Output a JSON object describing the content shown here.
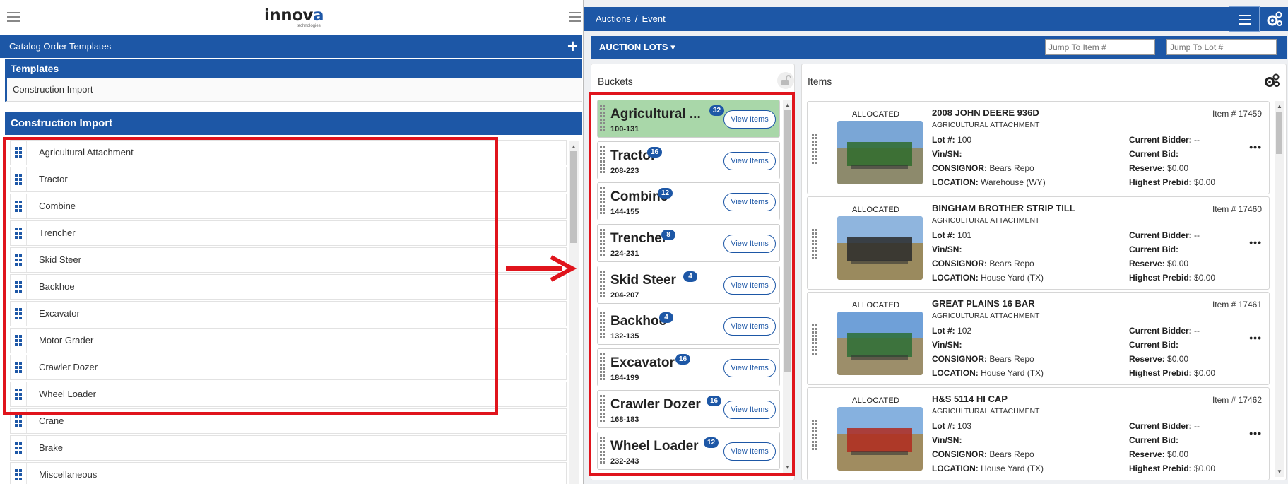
{
  "left": {
    "logo_main": "innova",
    "logo_sub": "technologies",
    "catalog_title": "Catalog Order Templates",
    "add_icon": "plus-icon",
    "templates_heading": "Templates",
    "selected_template": "Construction Import",
    "section_heading": "Construction Import",
    "items": [
      {
        "label": "Agricultural Attachment"
      },
      {
        "label": "Tractor"
      },
      {
        "label": "Combine"
      },
      {
        "label": "Trencher"
      },
      {
        "label": "Skid Steer"
      },
      {
        "label": "Backhoe"
      },
      {
        "label": "Excavator"
      },
      {
        "label": "Motor Grader"
      },
      {
        "label": "Crawler Dozer"
      },
      {
        "label": "Wheel Loader"
      },
      {
        "label": "Crane"
      },
      {
        "label": "Brake"
      },
      {
        "label": "Miscellaneous"
      }
    ]
  },
  "right": {
    "breadcrumb": {
      "first": "Auctions",
      "sep": "/",
      "second": "Event"
    },
    "lots_button": "AUCTION LOTS",
    "jump_item_placeholder": "Jump To Item #",
    "jump_lot_placeholder": "Jump To Lot #",
    "buckets_title": "Buckets",
    "items_title": "Items",
    "view_items_label": "View Items",
    "buckets": [
      {
        "name": "Agricultural ...",
        "range": "100-131",
        "count": "32",
        "active": true
      },
      {
        "name": "Tractor",
        "range": "208-223",
        "count": "16",
        "active": false
      },
      {
        "name": "Combine",
        "range": "144-155",
        "count": "12",
        "active": false
      },
      {
        "name": "Trencher",
        "range": "224-231",
        "count": "8",
        "active": false
      },
      {
        "name": "Skid Steer",
        "range": "204-207",
        "count": "4",
        "active": false
      },
      {
        "name": "Backhoe",
        "range": "132-135",
        "count": "4",
        "active": false
      },
      {
        "name": "Excavator",
        "range": "184-199",
        "count": "16",
        "active": false
      },
      {
        "name": "Crawler Dozer",
        "range": "168-183",
        "count": "16",
        "active": false
      },
      {
        "name": "Wheel Loader",
        "range": "232-243",
        "count": "12",
        "active": false
      }
    ],
    "labels": {
      "lot": "Lot #:",
      "vin": "Vin/SN:",
      "consignor": "CONSIGNOR:",
      "location": "LOCATION:",
      "bidder": "Current Bidder:",
      "bid": "Current Bid:",
      "reserve": "Reserve:",
      "prebid": "Highest Prebid:"
    },
    "cards": [
      {
        "status": "ALLOCATED",
        "title": "2008 JOHN DEERE 936D",
        "category": "AGRICULTURAL ATTACHMENT",
        "item_no": "Item # 17459",
        "lot": "100",
        "vin": "",
        "consignor": "Bears Repo",
        "location": "Warehouse (WY)",
        "bidder": "--",
        "bid": "",
        "reserve": "$0.00",
        "prebid": "$0.00",
        "more": "•••"
      },
      {
        "status": "ALLOCATED",
        "title": "BINGHAM BROTHER STRIP TILL",
        "category": "AGRICULTURAL ATTACHMENT",
        "item_no": "Item # 17460",
        "lot": "101",
        "vin": "",
        "consignor": "Bears Repo",
        "location": "House Yard (TX)",
        "bidder": "--",
        "bid": "",
        "reserve": "$0.00",
        "prebid": "$0.00",
        "more": "•••"
      },
      {
        "status": "ALLOCATED",
        "title": "GREAT PLAINS 16 BAR",
        "category": "AGRICULTURAL ATTACHMENT",
        "item_no": "Item # 17461",
        "lot": "102",
        "vin": "",
        "consignor": "Bears Repo",
        "location": "House Yard (TX)",
        "bidder": "--",
        "bid": "",
        "reserve": "$0.00",
        "prebid": "$0.00",
        "more": "•••"
      },
      {
        "status": "ALLOCATED",
        "title": "H&S 5114 HI CAP",
        "category": "AGRICULTURAL ATTACHMENT",
        "item_no": "Item # 17462",
        "lot": "103",
        "vin": "",
        "consignor": "Bears Repo",
        "location": "House Yard (TX)",
        "bidder": "--",
        "bid": "",
        "reserve": "$0.00",
        "prebid": "$0.00",
        "more": "•••"
      }
    ]
  },
  "colors": {
    "brand_blue": "#1d57a6",
    "highlight_red": "#e0141c",
    "active_bucket": "#a9d7a9"
  }
}
